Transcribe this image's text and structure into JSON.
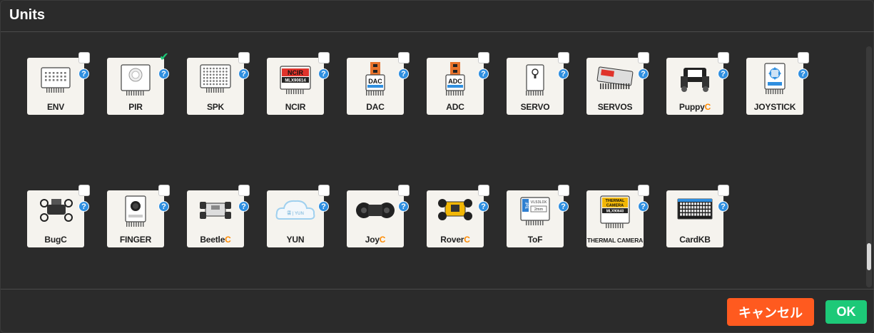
{
  "dialog": {
    "title": "Units"
  },
  "row1": [
    {
      "name": "env",
      "label": "ENV",
      "checked": false
    },
    {
      "name": "pir",
      "label": "PIR",
      "checked": true
    },
    {
      "name": "spk",
      "label": "SPK",
      "checked": false
    },
    {
      "name": "ncir",
      "label": "NCIR",
      "checked": false,
      "thumb_text": [
        "NCIR",
        "MLX90614"
      ]
    },
    {
      "name": "dac",
      "label": "DAC",
      "checked": false,
      "thumb_text": [
        "DAC"
      ]
    },
    {
      "name": "adc",
      "label": "ADC",
      "checked": false,
      "thumb_text": [
        "ADC"
      ]
    },
    {
      "name": "servo",
      "label": "SERVO",
      "checked": false
    },
    {
      "name": "servos",
      "label": "SERVOS",
      "checked": false
    },
    {
      "name": "puppyc",
      "label": "Puppy",
      "accent": "C",
      "checked": false
    },
    {
      "name": "joystick",
      "label": "JOYSTICK",
      "checked": false
    }
  ],
  "row2": [
    {
      "name": "bugc",
      "label": "BugC",
      "checked": false
    },
    {
      "name": "finger",
      "label": "FINGER",
      "checked": false
    },
    {
      "name": "beetlec",
      "label": "Beetle",
      "accent": "C",
      "checked": false
    },
    {
      "name": "yun",
      "label": "YUN",
      "checked": false
    },
    {
      "name": "joyc",
      "label": "Joy",
      "accent": "C",
      "checked": false
    },
    {
      "name": "roverc",
      "label": "Rover",
      "accent": "C",
      "checked": false
    },
    {
      "name": "tof",
      "label": "ToF",
      "checked": false,
      "thumb_text": [
        "ToF",
        "VL53L0X",
        "2mm"
      ]
    },
    {
      "name": "thermal-camera",
      "label": "THERMAL CAMERA",
      "checked": false,
      "thumb_text": [
        "THERMAL",
        "CAMERA",
        "MLX90640"
      ]
    },
    {
      "name": "cardkb",
      "label": "CardKB",
      "checked": false
    }
  ],
  "help_glyph": "?",
  "check_glyph": "✔",
  "footer": {
    "cancel_label": "キャンセル",
    "ok_label": "OK"
  },
  "colors": {
    "cancel": "#ff5a1f",
    "ok": "#1dc978",
    "accent": "#ff8a00",
    "help": "#2f8fe0",
    "background": "#2b2b2b"
  }
}
